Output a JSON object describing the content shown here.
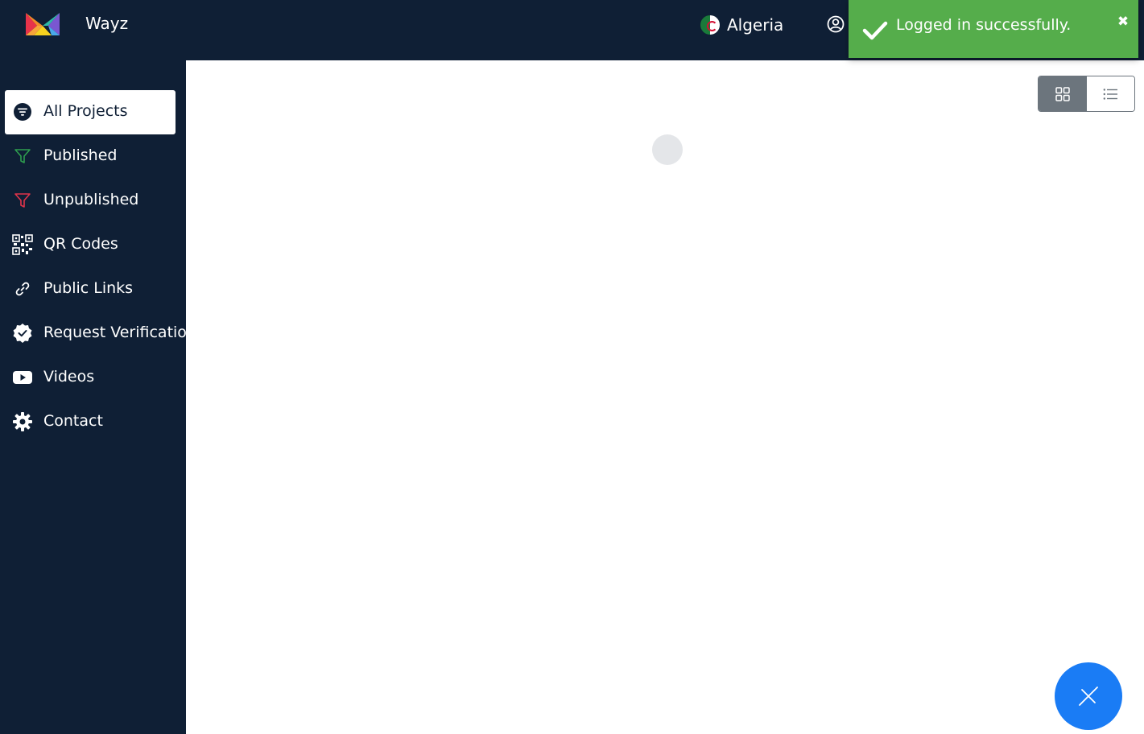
{
  "app": {
    "brand": "Wayz"
  },
  "header": {
    "country": "Algeria"
  },
  "sidebar": {
    "items": [
      {
        "label": "All Projects",
        "icon": "filter-circle-icon",
        "active": true
      },
      {
        "label": "Published",
        "icon": "funnel-icon",
        "color": "#2e9e4f"
      },
      {
        "label": "Unpublished",
        "icon": "funnel-icon",
        "color": "#e0344b"
      },
      {
        "label": "QR Codes",
        "icon": "qr-code-icon"
      },
      {
        "label": "Public Links",
        "icon": "link-icon"
      },
      {
        "label": "Request Verification",
        "icon": "verified-badge-icon"
      },
      {
        "label": "Videos",
        "icon": "youtube-icon"
      },
      {
        "label": "Contact",
        "icon": "gear-icon"
      }
    ]
  },
  "toast": {
    "message": "Logged in successfully."
  },
  "colors": {
    "navy": "#0f1f35",
    "toast_green": "#55ad4b",
    "fab_blue": "#1a7cf5",
    "toggle_gray": "#6c757d"
  }
}
